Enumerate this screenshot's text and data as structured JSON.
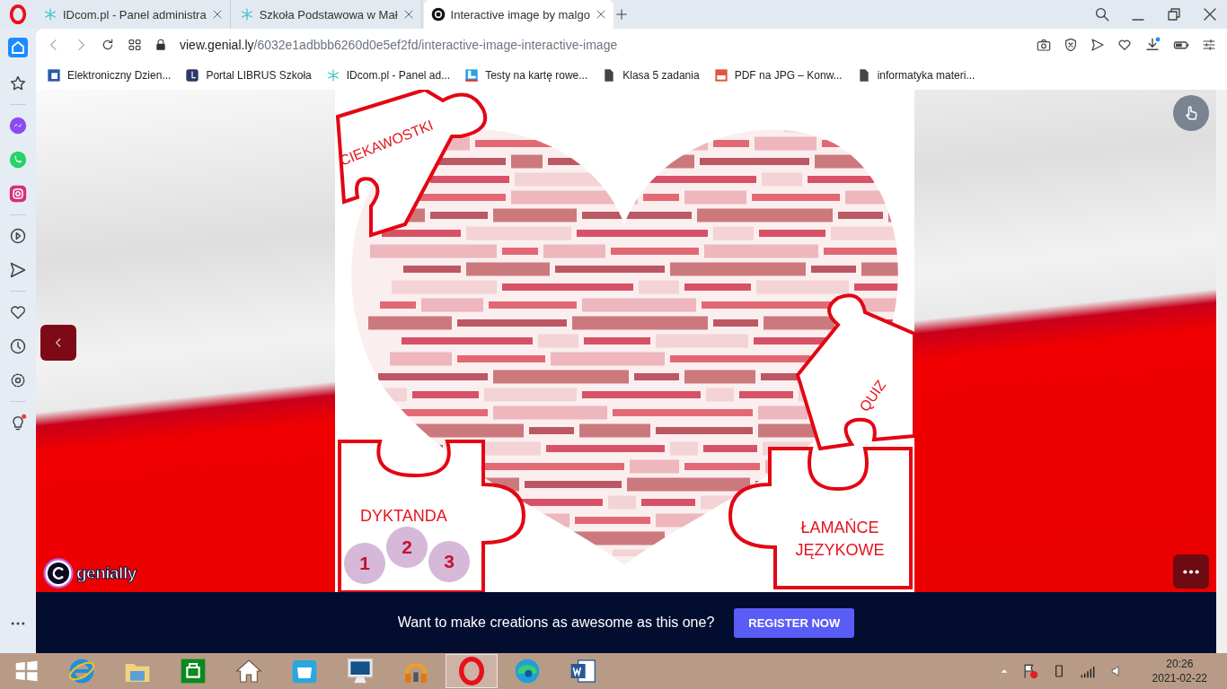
{
  "tabs": [
    {
      "title": "IDcom.pl - Panel administra",
      "selected": false
    },
    {
      "title": "Szkoła Podstawowa w Mał",
      "selected": false
    },
    {
      "title": "Interactive image by malgo",
      "selected": true
    }
  ],
  "address": {
    "host": "view.genial.ly",
    "path": "/6032e1adbbb6260d0e5ef2fd/interactive-image-interactive-image"
  },
  "bookmarks": [
    "Elektroniczny Dzien...",
    "Portal LIBRUS Szkoła",
    "IDcom.pl - Panel ad...",
    "Testy na kartę rowe...",
    "Klasa 5 zadania",
    "PDF na JPG – Konw...",
    "informatyka materi..."
  ],
  "image": {
    "hotspots": [
      {
        "kind": "corner",
        "label": "CIEKAWOSTKI"
      },
      {
        "kind": "corner",
        "label": "QUIZ"
      },
      {
        "kind": "numbers",
        "label": "DYKTANDA",
        "numbers": [
          "1",
          "2",
          "3"
        ]
      },
      {
        "kind": "plain",
        "label": "ŁAMAŃCE\nJĘZYKOWE"
      }
    ]
  },
  "logo": "genially",
  "banner": {
    "text": "Want to make creations as awesome as this one?",
    "button": "REGISTER NOW"
  },
  "taskbar": {
    "apps": [
      {
        "kind": "ie",
        "selected": false
      },
      {
        "kind": "folder",
        "selected": false
      },
      {
        "kind": "store",
        "selected": false
      },
      {
        "kind": "home",
        "selected": false
      },
      {
        "kind": "bag",
        "selected": false
      },
      {
        "kind": "monitor",
        "selected": false
      },
      {
        "kind": "music",
        "selected": false
      },
      {
        "kind": "opera",
        "selected": true
      },
      {
        "kind": "edge",
        "selected": false
      },
      {
        "kind": "word",
        "selected": false
      }
    ],
    "time": "20:26",
    "date": "2021-02-22"
  }
}
